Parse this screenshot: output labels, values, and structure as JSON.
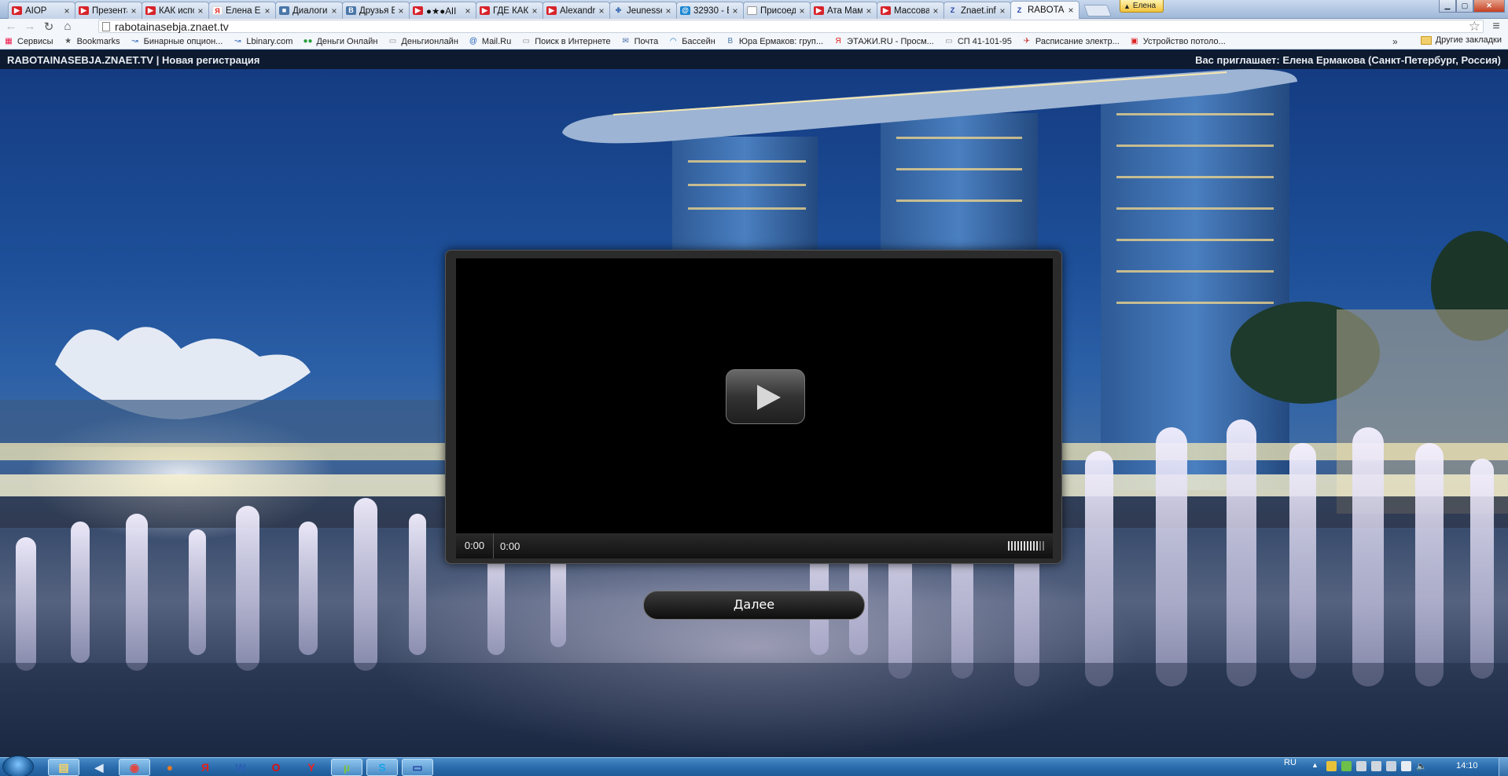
{
  "browser": {
    "tabs": [
      {
        "favicon": "youtube-icon",
        "title": "AIOP ",
        "active": false
      },
      {
        "favicon": "youtube-icon",
        "title": "Презента",
        "active": false
      },
      {
        "favicon": "youtube-icon",
        "title": "КАК испо",
        "active": false
      },
      {
        "favicon": "yandex-icon",
        "title": "Елена Ер",
        "active": false
      },
      {
        "favicon": "dialog-icon",
        "title": "Диалоги",
        "active": false
      },
      {
        "favicon": "vk-icon",
        "title": "Друзья Е",
        "active": false
      },
      {
        "favicon": "youtube-icon",
        "title": "●★●AII",
        "active": false
      },
      {
        "favicon": "youtube-icon",
        "title": "ГДЕ КАК",
        "active": false
      },
      {
        "favicon": "youtube-icon",
        "title": "Alexandr",
        "active": false
      },
      {
        "favicon": "jeunesse-icon",
        "title": "Jeunesse",
        "active": false
      },
      {
        "favicon": "mail-icon",
        "title": "32930 - В",
        "active": false
      },
      {
        "favicon": "document-icon",
        "title": "Присоед",
        "active": false
      },
      {
        "favicon": "youtube-icon",
        "title": "Ата Мам",
        "active": false
      },
      {
        "favicon": "youtube-icon",
        "title": "Массова",
        "active": false
      },
      {
        "favicon": "znaet-icon",
        "title": "Znaet.info",
        "active": false
      },
      {
        "favicon": "znaet-icon",
        "title": "RABOTAI",
        "active": true
      }
    ],
    "user_name": "Елена",
    "url": "rabotainasebja.znaet.tv",
    "bookmarks": [
      {
        "icon": "apps-icon",
        "label": "Сервисы"
      },
      {
        "icon": "star-icon",
        "label": "Bookmarks"
      },
      {
        "icon": "arrow-icon",
        "label": "Бинарные опцион..."
      },
      {
        "icon": "arrow-icon",
        "label": "Lbinary.com"
      },
      {
        "icon": "money-icon",
        "label": "Деньги Онлайн"
      },
      {
        "icon": "document-icon",
        "label": "Деньгионлайн"
      },
      {
        "icon": "mailru-icon",
        "label": "Mail.Ru"
      },
      {
        "icon": "document-icon",
        "label": "Поиск в Интернете"
      },
      {
        "icon": "mail-icon",
        "label": "Почта"
      },
      {
        "icon": "pool-icon",
        "label": "Бассейн"
      },
      {
        "icon": "vk-icon",
        "label": "Юра Ермаков: груп..."
      },
      {
        "icon": "yandex-icon",
        "label": "ЭТАЖИ.RU - Просм..."
      },
      {
        "icon": "document-icon",
        "label": "СП 41-101-95"
      },
      {
        "icon": "train-icon",
        "label": "Расписание электр..."
      },
      {
        "icon": "gift-icon",
        "label": "Устройство потоло..."
      }
    ],
    "bookmarks_more": "»",
    "other_bookmarks": "Другие закладки"
  },
  "site": {
    "brand": "RABOTAINASEBJA.ZNAET.TV",
    "separator": " | ",
    "section": "Новая регистрация",
    "invite": "Вас приглашает: Елена Ермакова (Санкт-Петербург, Россия)"
  },
  "player": {
    "elapsed": "0:00",
    "duration": "0:00",
    "volume_level": 0.8
  },
  "next_button": "Далее",
  "taskbar": {
    "apps": [
      "explorer-icon",
      "media-icon",
      "chrome-icon",
      "firefox-icon",
      "yandex-icon",
      "word-icon",
      "opera-icon",
      "yandex-browser-icon",
      "utorrent-icon",
      "skype-icon",
      "display-icon"
    ],
    "lang": "RU",
    "time": "14:10"
  }
}
